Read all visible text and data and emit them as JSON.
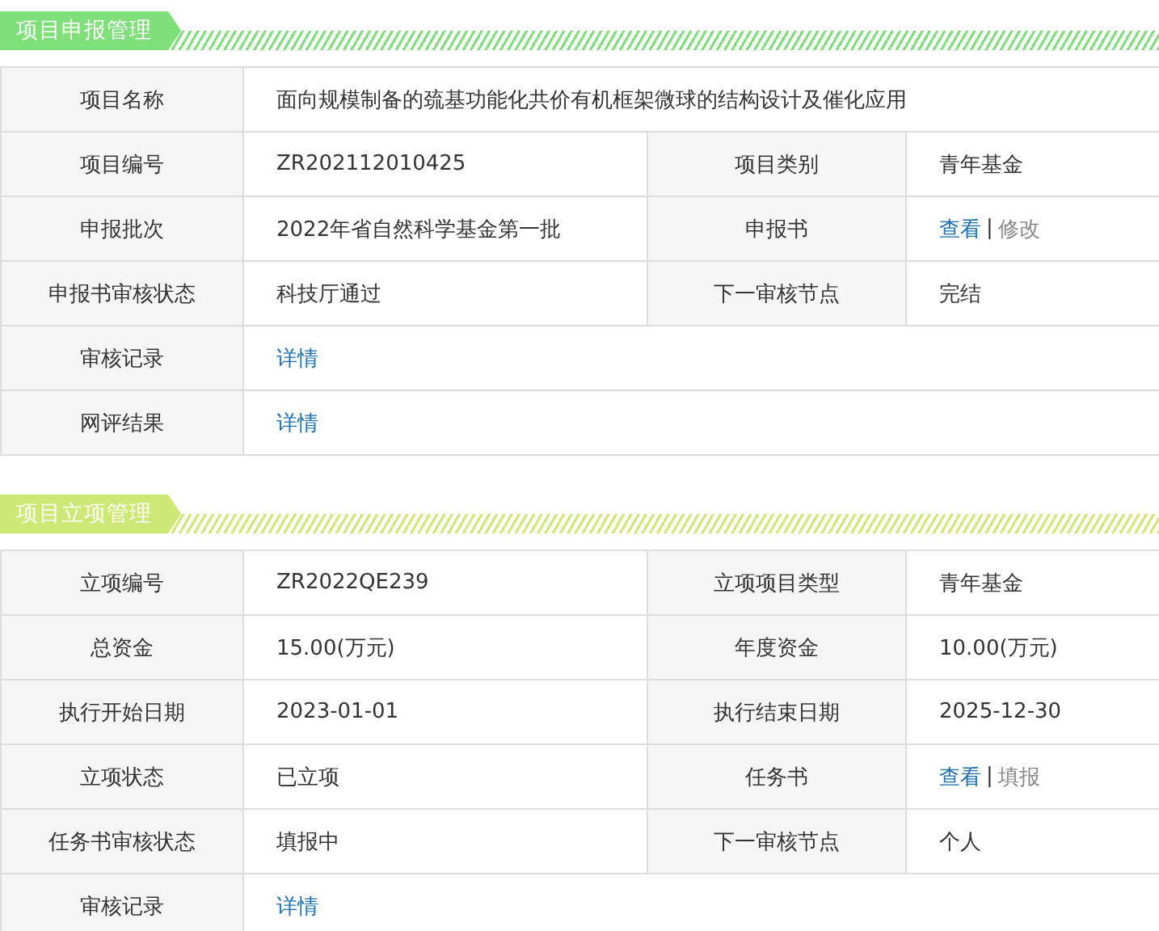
{
  "sections": [
    {
      "title": "项目申报管理",
      "color": "#7fe07a",
      "rows": [
        {
          "cells": [
            {
              "kind": "label",
              "text": "项目名称"
            },
            {
              "kind": "text",
              "text": "面向规模制备的巯基功能化共价有机框架微球的结构设计及催化应用"
            }
          ]
        },
        {
          "cells": [
            {
              "kind": "label",
              "text": "项目编号"
            },
            {
              "kind": "text",
              "text": "ZR202112010425"
            },
            {
              "kind": "label",
              "text": "项目类别"
            },
            {
              "kind": "text",
              "text": "青年基金"
            }
          ]
        },
        {
          "cells": [
            {
              "kind": "label",
              "text": "申报批次"
            },
            {
              "kind": "text",
              "text": "2022年省自然科学基金第一批"
            },
            {
              "kind": "label",
              "text": "申报书"
            },
            {
              "kind": "links",
              "separator": "|",
              "links": [
                {
                  "text": "查看",
                  "disabled": false
                },
                {
                  "text": "修改",
                  "disabled": true
                }
              ]
            }
          ]
        },
        {
          "cells": [
            {
              "kind": "label",
              "text": "申报书审核状态"
            },
            {
              "kind": "text",
              "text": "科技厅通过"
            },
            {
              "kind": "label",
              "text": "下一审核节点"
            },
            {
              "kind": "text",
              "text": "完结"
            }
          ]
        },
        {
          "cells": [
            {
              "kind": "label",
              "text": "审核记录"
            },
            {
              "kind": "links",
              "links": [
                {
                  "text": "详情",
                  "disabled": false
                }
              ]
            }
          ]
        },
        {
          "cells": [
            {
              "kind": "label",
              "text": "网评结果"
            },
            {
              "kind": "links",
              "links": [
                {
                  "text": "详情",
                  "disabled": false
                }
              ]
            }
          ]
        }
      ]
    },
    {
      "title": "项目立项管理",
      "color": "#cde874",
      "rows": [
        {
          "cells": [
            {
              "kind": "label",
              "text": "立项编号"
            },
            {
              "kind": "text",
              "text": "ZR2022QE239"
            },
            {
              "kind": "label",
              "text": "立项项目类型"
            },
            {
              "kind": "text",
              "text": "青年基金"
            }
          ]
        },
        {
          "cells": [
            {
              "kind": "label",
              "text": "总资金"
            },
            {
              "kind": "text",
              "text": "15.00(万元)"
            },
            {
              "kind": "label",
              "text": "年度资金"
            },
            {
              "kind": "text",
              "text": "10.00(万元)"
            }
          ]
        },
        {
          "cells": [
            {
              "kind": "label",
              "text": "执行开始日期"
            },
            {
              "kind": "text",
              "text": "2023-01-01"
            },
            {
              "kind": "label",
              "text": "执行结束日期"
            },
            {
              "kind": "text",
              "text": "2025-12-30"
            }
          ]
        },
        {
          "cells": [
            {
              "kind": "label",
              "text": "立项状态"
            },
            {
              "kind": "text",
              "text": "已立项"
            },
            {
              "kind": "label",
              "text": "任务书"
            },
            {
              "kind": "links",
              "separator": "|",
              "links": [
                {
                  "text": "查看",
                  "disabled": false
                },
                {
                  "text": "填报",
                  "disabled": true
                }
              ]
            }
          ]
        },
        {
          "cells": [
            {
              "kind": "label",
              "text": "任务书审核状态"
            },
            {
              "kind": "text",
              "text": "填报中"
            },
            {
              "kind": "label",
              "text": "下一审核节点"
            },
            {
              "kind": "text",
              "text": "个人"
            }
          ]
        },
        {
          "cells": [
            {
              "kind": "label",
              "text": "审核记录"
            },
            {
              "kind": "links",
              "links": [
                {
                  "text": "详情",
                  "disabled": false
                }
              ]
            }
          ]
        }
      ]
    }
  ]
}
